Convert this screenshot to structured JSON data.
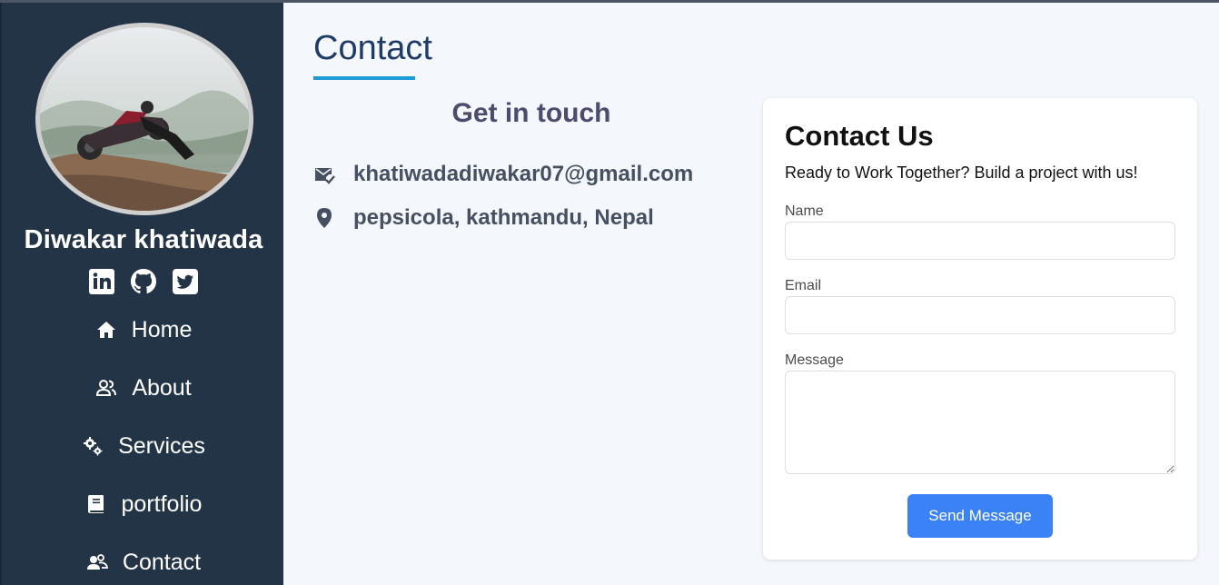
{
  "sidebar": {
    "name": "Diwakar khatiwada",
    "socials": [
      {
        "icon": "linkedin-icon"
      },
      {
        "icon": "github-icon"
      },
      {
        "icon": "twitter-icon"
      }
    ],
    "nav": [
      {
        "label": "Home",
        "icon": "home-icon"
      },
      {
        "label": "About",
        "icon": "users-icon"
      },
      {
        "label": "Services",
        "icon": "gears-icon"
      },
      {
        "label": "portfolio",
        "icon": "book-icon"
      },
      {
        "label": "Contact",
        "icon": "contact-icon"
      }
    ]
  },
  "main": {
    "title": "Contact",
    "get_in_touch": "Get in touch",
    "email": "khatiwadadiwakar07@gmail.com",
    "address": "pepsicola, kathmandu, Nepal"
  },
  "form": {
    "title": "Contact Us",
    "subtitle": "Ready to Work Together? Build a project with us!",
    "name_label": "Name",
    "name_value": "",
    "email_label": "Email",
    "email_value": "",
    "message_label": "Message",
    "message_value": "",
    "submit_label": "Send Message"
  },
  "colors": {
    "sidebar_bg": "#243447",
    "accent": "#1e9bd7",
    "title": "#1f3c68",
    "button": "#3b82f6"
  }
}
